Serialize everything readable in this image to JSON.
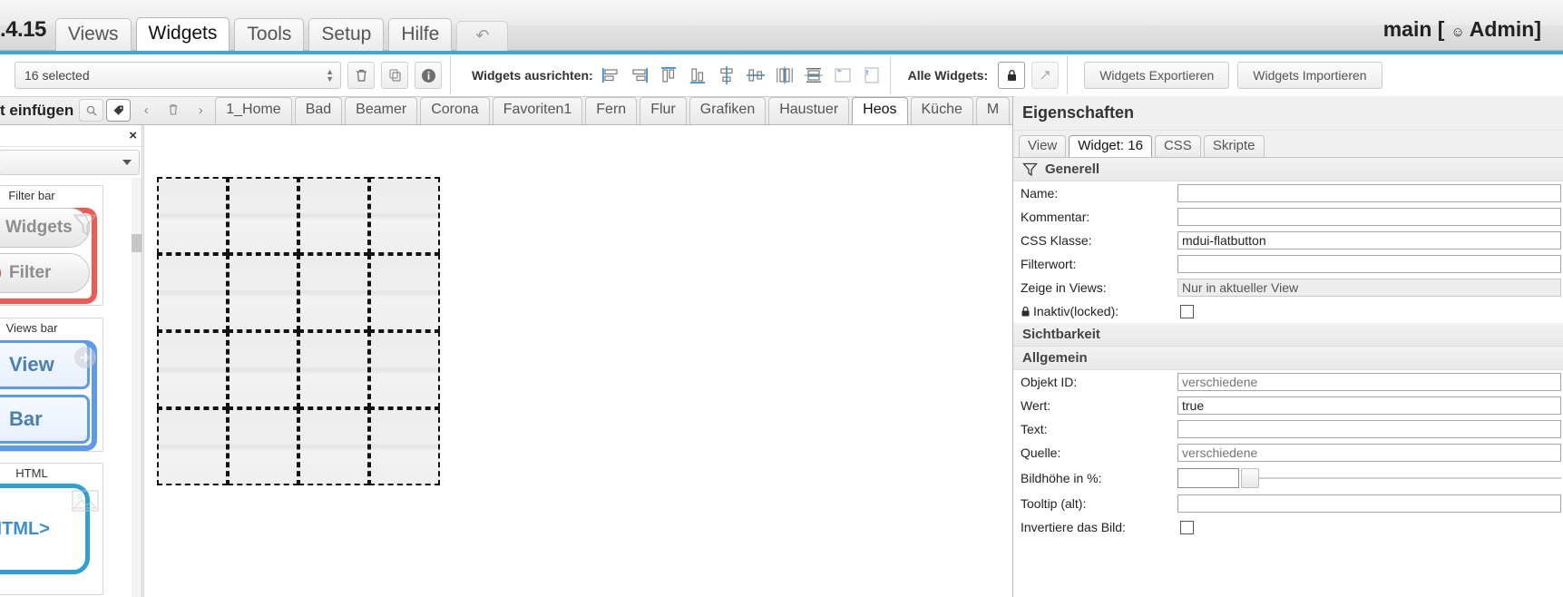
{
  "menubar": {
    "version": ".4.15",
    "items": [
      {
        "label": "Views",
        "active": false
      },
      {
        "label": "Widgets",
        "active": true
      },
      {
        "label": "Tools",
        "active": false
      },
      {
        "label": "Setup",
        "active": false
      },
      {
        "label": "Hilfe",
        "active": false
      }
    ],
    "undo_label": "↶",
    "project_title": "main [",
    "user_name": "Admin",
    "title_close": "]"
  },
  "toolbar": {
    "selection_value": "16 selected",
    "delete_title": "delete-widget",
    "copy_title": "copy-widget",
    "info_title": "widget-info",
    "align_label": "Widgets ausrichten:",
    "align_buttons": [
      "align-left",
      "align-right",
      "align-top",
      "align-bottom",
      "align-center-horizontal",
      "align-center-vertical",
      "distribute-horizontal",
      "distribute-vertical",
      "same-width",
      "same-height"
    ],
    "all_widgets_label": "Alle Widgets:",
    "lock_label": "lock-all-widgets",
    "unlock_label": "expand-all-widgets",
    "export_label": "Widgets Exportieren",
    "import_label": "Widgets Importieren"
  },
  "viewsbar": {
    "insert_label": "t einfügen",
    "mini_buttons": [
      {
        "name": "magnifier-icon",
        "glyph": "⚲",
        "active": false
      },
      {
        "name": "tag-icon",
        "glyph": "⬟",
        "active": true
      }
    ],
    "nav_prev": "‹",
    "nav_delete": "☐",
    "nav_next": "›",
    "tabs": [
      {
        "label": "1_Home",
        "active": false
      },
      {
        "label": "Bad",
        "active": false
      },
      {
        "label": "Beamer",
        "active": false
      },
      {
        "label": "Corona",
        "active": false
      },
      {
        "label": "Favoriten1",
        "active": false
      },
      {
        "label": "Fern",
        "active": false
      },
      {
        "label": "Flur",
        "active": false
      },
      {
        "label": "Grafiken",
        "active": false
      },
      {
        "label": "Haustuer",
        "active": false
      },
      {
        "label": "Heos",
        "active": true
      },
      {
        "label": "Küche",
        "active": false
      },
      {
        "label": "M",
        "active": false
      }
    ]
  },
  "palette": {
    "close_label": "×",
    "groups": [
      {
        "title": "Filter bar",
        "outline": "red",
        "outline_color": "#f4584e",
        "corner_icon": "filter-funnel-icon",
        "items": [
          {
            "label": "Widgets",
            "icon": "widgets-icon"
          },
          {
            "label": "Filter",
            "icon": "no-filter-icon"
          }
        ]
      },
      {
        "title": "Views bar",
        "outline": "blue",
        "outline_color": "#5b9bef",
        "corner_icon": "arrow-right-circle-icon",
        "items": [
          {
            "label": "View",
            "icon": "view-lock-icon"
          },
          {
            "label": "Bar",
            "icon": "refresh-icon"
          }
        ]
      },
      {
        "title": "HTML",
        "outline": "none",
        "outline_color": "#2f9fd6",
        "corner_icon": "image-placeholder-icon",
        "items": [
          {
            "label": "<HTML>",
            "icon": "html-icon"
          }
        ]
      }
    ]
  },
  "canvas": {
    "grid_rows": 4,
    "grid_cols": 4,
    "cell_label": ""
  },
  "properties": {
    "header": "Eigenschaften",
    "tabs": [
      {
        "label": "View",
        "active": false
      },
      {
        "label": "Widget: 16",
        "active": true
      },
      {
        "label": "CSS",
        "active": false
      },
      {
        "label": "Skripte",
        "active": false
      }
    ],
    "sections": [
      {
        "name": "Generell",
        "icon": "filter-funnel-icon",
        "rows": [
          {
            "label": "Name:",
            "type": "text",
            "value": "",
            "placeholder": ""
          },
          {
            "label": "Kommentar:",
            "type": "text",
            "value": "",
            "placeholder": ""
          },
          {
            "label": "CSS Klasse:",
            "type": "text",
            "value": "mdui-flatbutton",
            "placeholder": ""
          },
          {
            "label": "Filterwort:",
            "type": "text",
            "value": "",
            "placeholder": ""
          },
          {
            "label": "Zeige in Views:",
            "type": "readonly",
            "value": "Nur in aktueller View",
            "placeholder": ""
          },
          {
            "label": "Inaktiv(locked):",
            "type": "checkbox",
            "value": "",
            "icon": "lock-icon",
            "checked": false
          }
        ]
      },
      {
        "name": "Sichtbarkeit",
        "icon": "",
        "rows": []
      },
      {
        "name": "Allgemein",
        "icon": "",
        "rows": [
          {
            "label": "Objekt ID:",
            "type": "text",
            "value": "",
            "placeholder": "verschiedene"
          },
          {
            "label": "Wert:",
            "type": "text",
            "value": "true",
            "placeholder": ""
          },
          {
            "label": "Text:",
            "type": "text",
            "value": "",
            "placeholder": ""
          },
          {
            "label": "Quelle:",
            "type": "text",
            "value": "",
            "placeholder": "verschiedene"
          },
          {
            "label": "Bildhöhe in %:",
            "type": "slider",
            "value": "",
            "placeholder": ""
          },
          {
            "label": "Tooltip (alt):",
            "type": "text",
            "value": "",
            "placeholder": ""
          },
          {
            "label": "Invertiere das Bild:",
            "type": "checkbox",
            "value": "",
            "checked": false
          }
        ]
      }
    ]
  },
  "colors": {
    "accent": "#3ea6d8",
    "palette_red": "#f4584e",
    "palette_blue": "#5b9bef",
    "html_blue": "#2f9fd6"
  }
}
